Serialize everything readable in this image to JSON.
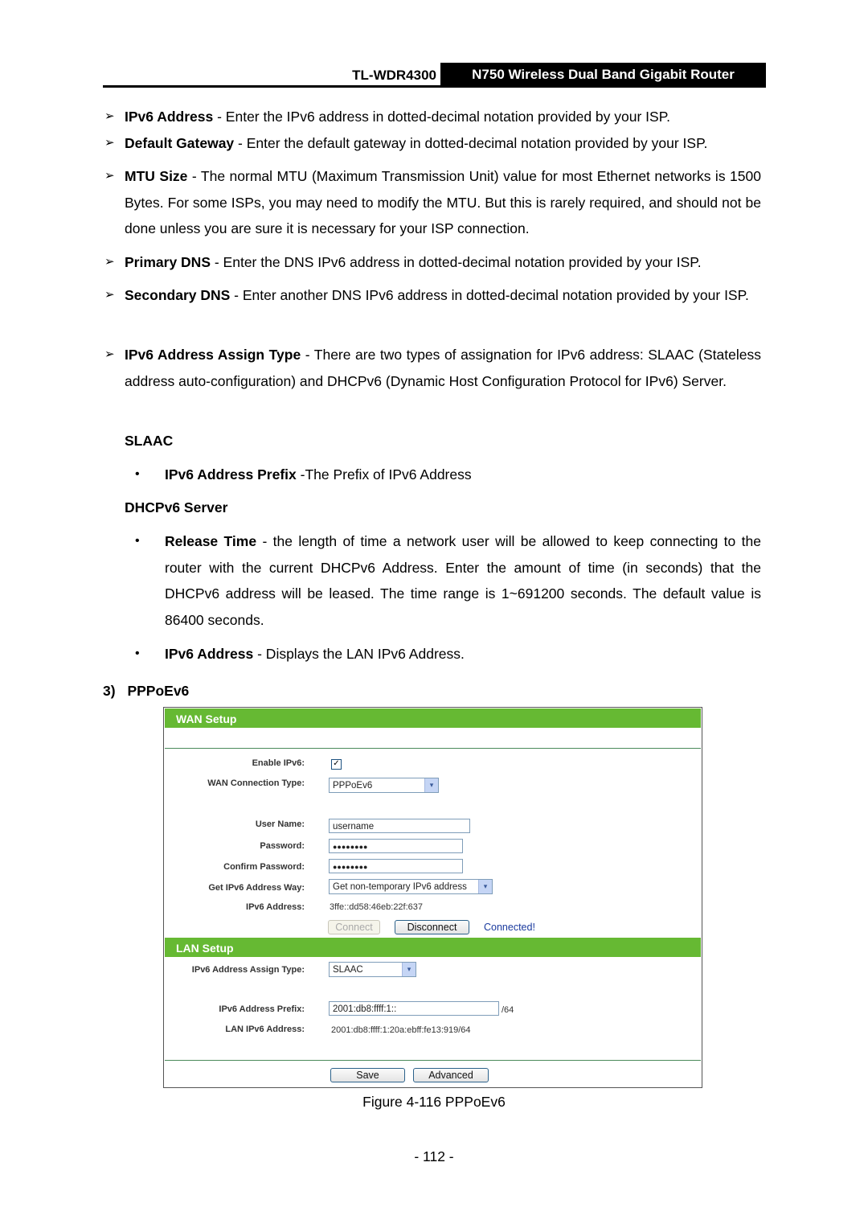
{
  "header": {
    "model": "TL-WDR4300",
    "title": "N750 Wireless Dual Band Gigabit Router"
  },
  "items": [
    {
      "term": "IPv6 Address",
      "text": " - Enter the IPv6 address in dotted-decimal notation provided by your ISP."
    },
    {
      "term": "Default Gateway",
      "text": " - Enter the default gateway in dotted-decimal notation provided by your ISP."
    },
    {
      "term": "MTU Size",
      "text": " - The normal MTU (Maximum Transmission Unit) value for most Ethernet networks is 1500 Bytes. For some ISPs, you may need to modify the MTU. But this is rarely required, and should not be done unless you are sure it is necessary for your ISP connection."
    },
    {
      "term": "Primary DNS",
      "text": " - Enter the DNS IPv6 address in dotted-decimal notation provided by your ISP."
    },
    {
      "term": "Secondary DNS",
      "text": " - Enter another DNS IPv6 address in dotted-decimal notation provided by your ISP."
    },
    {
      "term": "IPv6 Address Assign Type",
      "text": " - There are two types of assignation for IPv6 address: SLAAC (Stateless address auto-configuration) and DHCPv6 (Dynamic Host Configuration Protocol for IPv6) Server."
    }
  ],
  "slaac": {
    "heading": "SLAAC",
    "bullets": [
      {
        "term": "IPv6 Address Prefix",
        "text": " -The Prefix of IPv6 Address"
      }
    ]
  },
  "dhcp": {
    "heading": "DHCPv6 Server",
    "bullets": [
      {
        "term": "Release Time",
        "text": " - the length of time a network user will be allowed to keep connecting to the router with the current DHCPv6 Address. Enter the amount of time (in seconds) that the DHCPv6 address will be leased. The time range is 1~691200 seconds. The default value is 86400 seconds."
      },
      {
        "term": "IPv6 Address",
        "text": " - Displays the LAN IPv6 Address."
      }
    ]
  },
  "section": {
    "number": "3)",
    "title": "PPPoEv6"
  },
  "figure": {
    "wan_title": "WAN Setup",
    "enable_ipv6_label": "Enable IPv6:",
    "enable_ipv6_checked": true,
    "check_glyph": "✓",
    "wan_type_label": "WAN Connection Type:",
    "wan_type_value": "PPPoEv6",
    "username_label": "User Name:",
    "username_value": "username",
    "password_label": "Password:",
    "password_value": "●●●●●●●●",
    "confirm_label": "Confirm Password:",
    "confirm_value": "●●●●●●●●",
    "addr_way_label": "Get IPv6 Address Way:",
    "addr_way_value": "Get non-temporary IPv6 address",
    "ipv6_addr_label": "IPv6 Address:",
    "ipv6_addr_value": "3ffe::dd58:46eb:22f:637",
    "connect_label": "Connect",
    "disconnect_label": "Disconnect",
    "status": "Connected!",
    "status_color": "#1a3a9e",
    "lan_title": "LAN Setup",
    "assign_type_label": "IPv6 Address Assign Type:",
    "assign_type_value": "SLAAC",
    "prefix_label": "IPv6 Address Prefix:",
    "prefix_value": "2001:db8:ffff:1::",
    "prefix_suffix": "/64",
    "lan_addr_label": "LAN IPv6 Address:",
    "lan_addr_value": "2001:db8:ffff:1:20a:ebff:fe13:919/64",
    "save_label": "Save",
    "advanced_label": "Advanced",
    "dropdown_glyph": "▾",
    "bar_color": "#66b933"
  },
  "caption": "Figure 4-116 PPPoEv6",
  "page_number": "- 112 -",
  "icons": {
    "arrow_bullet": "➢",
    "dot_bullet": "•"
  }
}
